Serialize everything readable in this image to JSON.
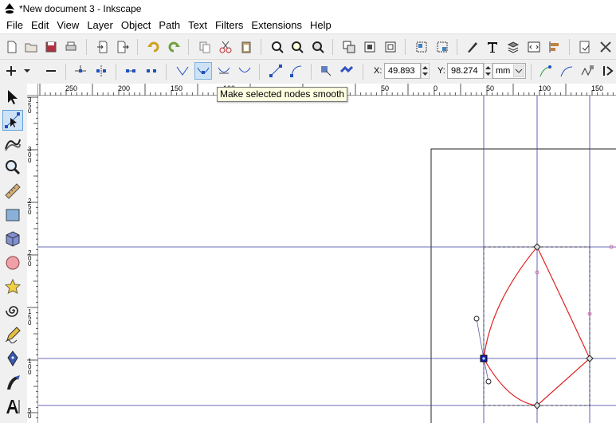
{
  "window": {
    "title": "*New document 3 - Inkscape"
  },
  "menu": [
    "File",
    "Edit",
    "View",
    "Layer",
    "Object",
    "Path",
    "Text",
    "Filters",
    "Extensions",
    "Help"
  ],
  "node_toolbar": {
    "x_label": "X:",
    "x_value": "49.893",
    "y_label": "Y:",
    "y_value": "98.274",
    "unit": "mm"
  },
  "tooltip": "Make selected nodes smooth",
  "hruler_labels": [
    "250",
    "200",
    "150",
    "100",
    "50",
    "0",
    "50",
    "100",
    "150"
  ],
  "vruler_labels": [
    "350",
    "300",
    "250",
    "200",
    "150",
    "100",
    "50"
  ],
  "colors": {
    "path": "#e02020",
    "guide": "#3a3aa0",
    "node_selected": "#1020c0",
    "active_tool": "#cde3f5"
  },
  "icons": {
    "tools": [
      "selector-icon",
      "node-editor-icon",
      "tweak-icon",
      "zoom-icon",
      "measure-icon",
      "rectangle-icon",
      "3d-box-icon",
      "ellipse-icon",
      "star-icon",
      "spiral-icon",
      "pencil-icon",
      "pen-icon",
      "calligraphy-icon",
      "text-icon"
    ]
  }
}
